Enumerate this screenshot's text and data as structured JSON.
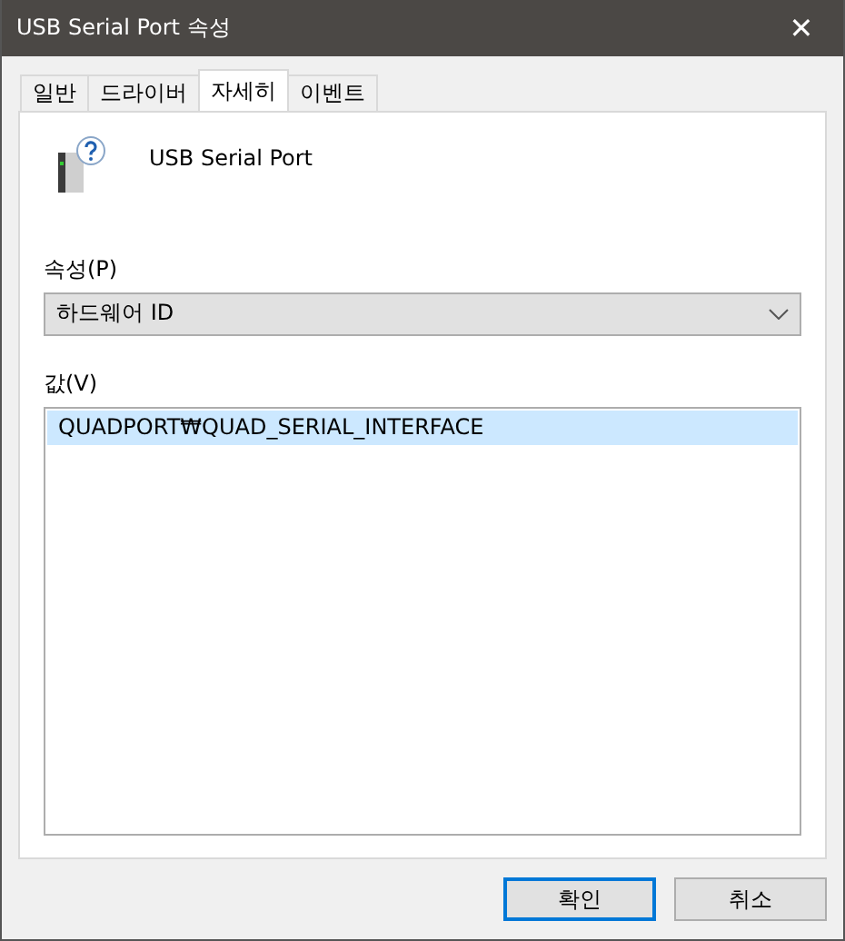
{
  "window": {
    "title": "USB Serial Port 속성",
    "close": "✕"
  },
  "tabs": [
    {
      "label": "일반",
      "selected": false
    },
    {
      "label": "드라이버",
      "selected": false
    },
    {
      "label": "자세히",
      "selected": true
    },
    {
      "label": "이벤트",
      "selected": false
    }
  ],
  "device": {
    "name": "USB Serial Port"
  },
  "property": {
    "label": "속성(P)",
    "value": "하드웨어 ID"
  },
  "values": {
    "label": "값(V)",
    "items": [
      {
        "text": "QUADPORT₩QUAD_SERIAL_INTERFACE",
        "selected": true
      }
    ]
  },
  "buttons": [
    {
      "label": "확인",
      "focused": true
    },
    {
      "label": "취소",
      "focused": false
    }
  ]
}
